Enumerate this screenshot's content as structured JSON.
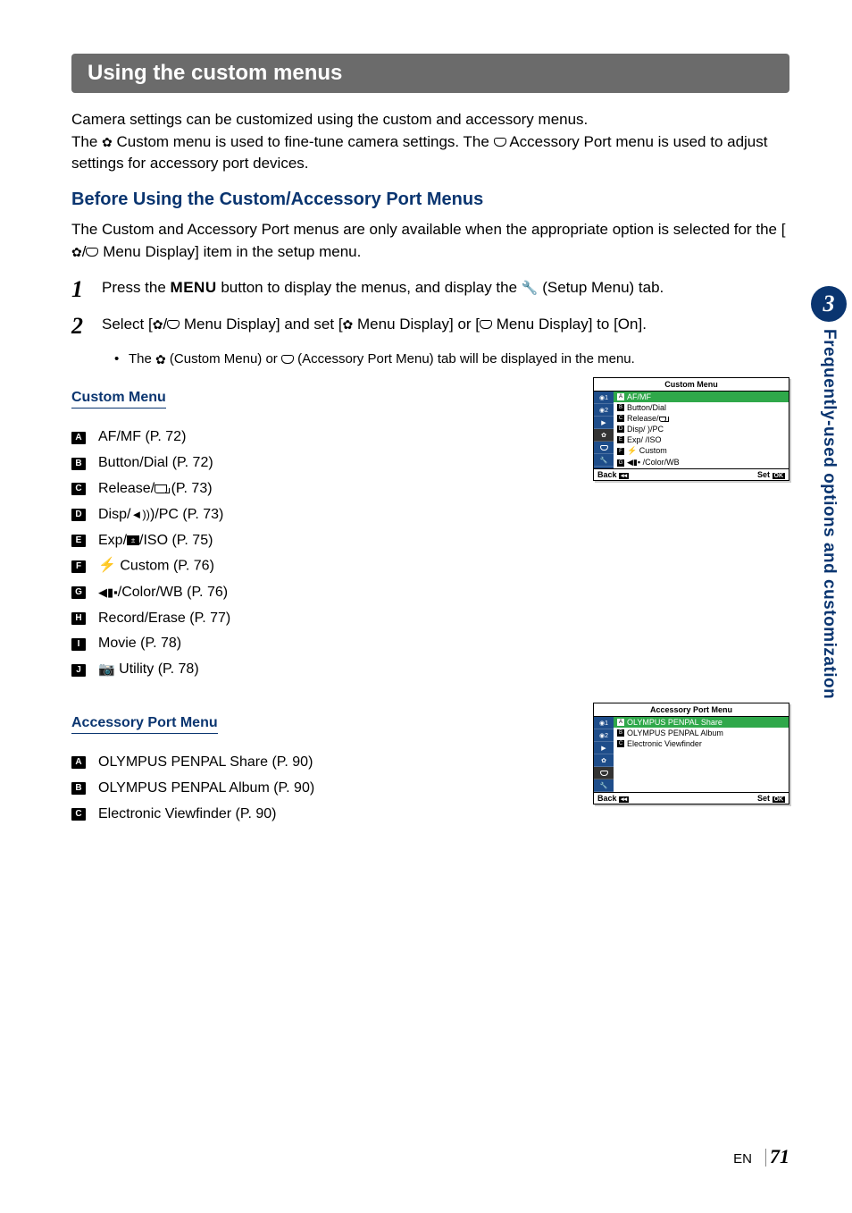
{
  "side": {
    "chapter_number": "3",
    "chapter_title": "Frequently-used options and customization"
  },
  "heading": "Using the custom menus",
  "intro": {
    "line1": "Camera settings can be customized using the custom and accessory menus.",
    "line2_a": "The ",
    "line2_b": " Custom menu is used to fine-tune camera settings. The ",
    "line2_c": " Accessory Port menu is used to adjust settings for accessory port devices."
  },
  "subheading": "Before Using the Custom/Accessory Port Menus",
  "before_text_a": "The Custom and Accessory Port menus are only available when the appropriate option is selected for the [",
  "before_text_b": " Menu Display] item in the setup menu.",
  "steps": {
    "s1": {
      "num": "1",
      "text_a": "Press the ",
      "menu_word": "MENU",
      "text_b": " button to display the menus, and display the ",
      "text_c": " (Setup Menu) tab."
    },
    "s2": {
      "num": "2",
      "text_a": "Select [",
      "text_b": " Menu Display] and set [",
      "text_c": " Menu Display] or [",
      "text_d": " Menu Display] to [On]."
    },
    "sub": {
      "a": "The ",
      "b": " (Custom Menu) or ",
      "c": " (Accessory Port Menu) tab will be displayed in the menu."
    }
  },
  "custom_menu": {
    "title": "Custom Menu",
    "items": [
      {
        "tag": "A",
        "label": "AF/MF (P. 72)"
      },
      {
        "tag": "B",
        "label": "Button/Dial (P. 72)"
      },
      {
        "tag": "C",
        "label_a": "Release/",
        "label_b": " (P. 73)"
      },
      {
        "tag": "D",
        "label_a": "Disp/",
        "label_b": ")/PC (P. 73)"
      },
      {
        "tag": "E",
        "label_a": "Exp/",
        "label_b": "/ISO (P. 75)"
      },
      {
        "tag": "F",
        "label_a": " Custom (P. 76)"
      },
      {
        "tag": "G",
        "label_a": "/Color/WB (P. 76)"
      },
      {
        "tag": "H",
        "label": "Record/Erase (P. 77)"
      },
      {
        "tag": "I",
        "label": "Movie (P. 78)"
      },
      {
        "tag": "J",
        "label_a": " Utility (P. 78)"
      }
    ]
  },
  "accessory_menu": {
    "title": "Accessory Port Menu",
    "items": [
      {
        "tag": "A",
        "label": "OLYMPUS PENPAL Share (P. 90)"
      },
      {
        "tag": "B",
        "label": "OLYMPUS PENPAL Album (P. 90)"
      },
      {
        "tag": "C",
        "label": "Electronic Viewfinder (P. 90)"
      }
    ]
  },
  "camera_screens": {
    "custom": {
      "title": "Custom Menu",
      "rows": [
        "AF/MF",
        "Button/Dial",
        "Release/",
        "Disp/ )/PC",
        "Exp/ /ISO",
        " Custom",
        " /Color/WB"
      ],
      "back": "Back",
      "set": "Set"
    },
    "accessory": {
      "title": "Accessory Port Menu",
      "rows": [
        "OLYMPUS PENPAL Share",
        "OLYMPUS PENPAL Album",
        "Electronic Viewfinder"
      ],
      "back": "Back",
      "set": "Set"
    }
  },
  "footer": {
    "en": "EN",
    "page": "71"
  }
}
